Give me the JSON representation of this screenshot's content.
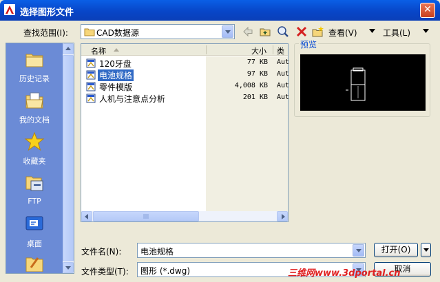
{
  "window": {
    "title": "选择图形文件",
    "close_symbol": "✕"
  },
  "toolbar": {
    "look_in_label": "查找范围(I):",
    "look_in_value": "CAD数据源",
    "view_label": "查看(V)",
    "tools_label": "工具(L)"
  },
  "places": [
    {
      "label": "历史记录",
      "icon": "folder-history-icon"
    },
    {
      "label": "我的文档",
      "icon": "my-documents-icon"
    },
    {
      "label": "收藏夹",
      "icon": "favorites-star-icon"
    },
    {
      "label": "FTP",
      "icon": "ftp-icon"
    },
    {
      "label": "桌面",
      "icon": "desktop-icon"
    }
  ],
  "file_list": {
    "columns": [
      "名称",
      "大小",
      "类"
    ],
    "files": [
      {
        "name": "120牙盘",
        "size": "77 KB",
        "type": "Aut"
      },
      {
        "name": "电池规格",
        "size": "97 KB",
        "type": "Aut",
        "selected": true
      },
      {
        "name": "零件模版",
        "size": "4,008 KB",
        "type": "Aut"
      },
      {
        "name": "人机与注意点分析",
        "size": "201 KB",
        "type": "Aut"
      }
    ]
  },
  "preview": {
    "label": "预览"
  },
  "form": {
    "filename_label": "文件名(N):",
    "filename_value": "电池规格",
    "filetype_label": "文件类型(T):",
    "filetype_value": "图形 (*.dwg)",
    "open_label": "打开(O)",
    "cancel_label": "取消"
  },
  "watermark": "三维网www.3dportal.cn",
  "colors": {
    "title_bar": "#0846c8",
    "places_bar": "#6b8bd6",
    "selection": "#316ac5",
    "watermark": "#e02020"
  }
}
